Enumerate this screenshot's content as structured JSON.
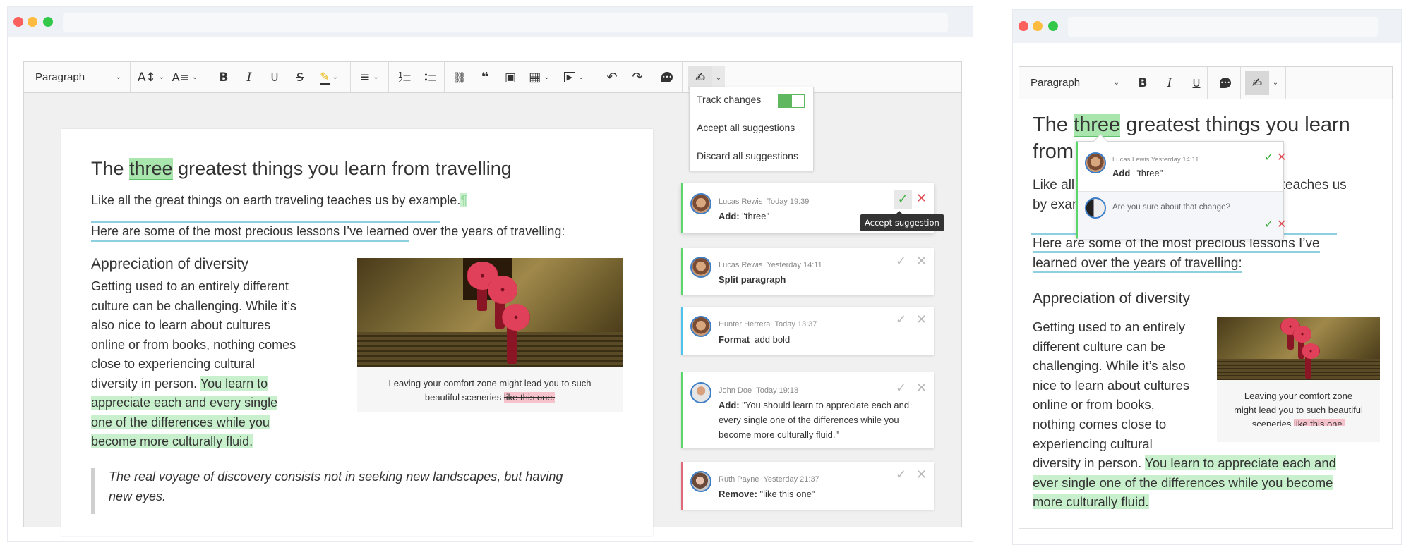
{
  "left_window": {
    "toolbar": {
      "heading_select": "Paragraph",
      "icons": [
        "font-size-icon",
        "font-family-icon",
        "bold-icon",
        "italic-icon",
        "underline-icon",
        "strikethrough-icon",
        "highlight-icon",
        "align-icon",
        "numbered-list-icon",
        "bulleted-list-icon",
        "link-icon",
        "blockquote-icon",
        "image-icon",
        "table-icon",
        "media-embed-icon",
        "undo-icon",
        "redo-icon",
        "comment-icon",
        "track-changes-icon"
      ],
      "glyphs": {
        "font_size": "A↕",
        "font_family": "A≡",
        "bold": "B",
        "italic": "I",
        "underline": "U",
        "strike": "S",
        "highlight": "✎",
        "align": "≡",
        "numbered": "⒈",
        "bulleted": "•",
        "link": "⛓",
        "quote": "❝",
        "image": "▣",
        "table": "▦",
        "media": "▶",
        "undo": "↶",
        "redo": "↷",
        "comment": "●",
        "track": "✍",
        "chevron": "⌄"
      }
    },
    "track_menu": {
      "track_changes_label": "Track changes",
      "track_changes_enabled": true,
      "accept_all": "Accept all suggestions",
      "discard_all": "Discard all suggestions"
    },
    "document": {
      "title_before": "The ",
      "title_inserted": "three",
      "title_after": " greatest things you learn from travelling",
      "para1": "Like all the great things on earth traveling teaches us by example.",
      "para1_mark": "¶",
      "para2_split": "Here are some of the most precious lessons I’ve learned",
      "para2_rest": " over the years of travelling:",
      "subheading": "Appreciation of diversity",
      "body_lines": [
        "Getting used to an entirely different",
        "culture can be challenging. While it’s",
        "also nice to learn about cultures",
        "online or from books, nothing comes",
        "close to experiencing cultural"
      ],
      "body_line6_plain": "diversity in person. ",
      "body_line6_ins": "You learn to",
      "body_ins_lines": [
        "appreciate each and every single",
        "one of the differences while you",
        "become more culturally fluid."
      ],
      "caption_line1": "Leaving your comfort zone might lead you to such",
      "caption_line2_plain": "beautiful sceneries ",
      "caption_line2_del": "like this one.",
      "quote_line1": "The real voyage of discovery consists not in seeking new landscapes, but having",
      "quote_line2": "new eyes."
    },
    "suggestions": [
      {
        "author": "Lucas Rewis",
        "time": "Today 19:39",
        "type": "Add:",
        "content": "\"three\"",
        "color": "#5bd66b",
        "active": true
      },
      {
        "author": "Lucas Rewis",
        "time": "Yesterday 14:11",
        "type": "Split paragraph",
        "content": "",
        "color": "#5bd66b",
        "active": false
      },
      {
        "author": "Hunter Herrera",
        "time": "Today 13:37",
        "type": "Format",
        "content": "add bold",
        "color": "#4ec3ec",
        "active": false
      },
      {
        "author": "John Doe",
        "time": "Today 19:18",
        "type": "Add:",
        "content": "\"You should learn to appreciate each and",
        "content2": "every single one of the differences while you",
        "content3": "become more culturally fluid.\"",
        "color": "#5bd66b",
        "active": false
      },
      {
        "author": "Ruth Payne",
        "time": "Yesterday 21:37",
        "type": "Remove:",
        "content": "\"like this one\"",
        "color": "#e06a7a",
        "active": false
      }
    ],
    "tooltip": "Accept suggestion",
    "accept_glyph": "✓",
    "reject_glyph": "✕"
  },
  "right_window": {
    "toolbar": {
      "heading_select": "Paragraph"
    },
    "document": {
      "title_line1_before": "The ",
      "title_inserted": "three",
      "title_line1_after": " greatest things you learn",
      "title_line2": "from travelling",
      "para1_line1": "Like all the great things on earth traveling teaches us",
      "para1_line2": "by example.",
      "para2_line1": "Here are some of the most precious lessons I’ve",
      "para2_line2": "learned over the years of travelling:",
      "subheading": "Appreciation of diversity",
      "body_lines": [
        "Getting used to an entirely",
        "different culture can be",
        "challenging. While it’s also",
        "nice to learn about cultures",
        "online or from books,",
        "nothing comes close to",
        "experiencing cultural"
      ],
      "body_line8_plain": "diversity in person. ",
      "body_line8_ins": "You learn to appreciate each and",
      "body_ins_lines": [
        "ever single  one of the differences while you become",
        "more culturally fluid."
      ],
      "caption_line1": "Leaving your comfort zone",
      "caption_line2": "might lead you to such beautiful",
      "caption_line3_plain": "sceneries ",
      "caption_line3_del": "like this one."
    },
    "popup": {
      "author": "Lucas Lewis",
      "time": "Yesterday 14:11",
      "type": "Add",
      "content": "\"three\"",
      "reply": "Are you sure about that change?"
    }
  }
}
